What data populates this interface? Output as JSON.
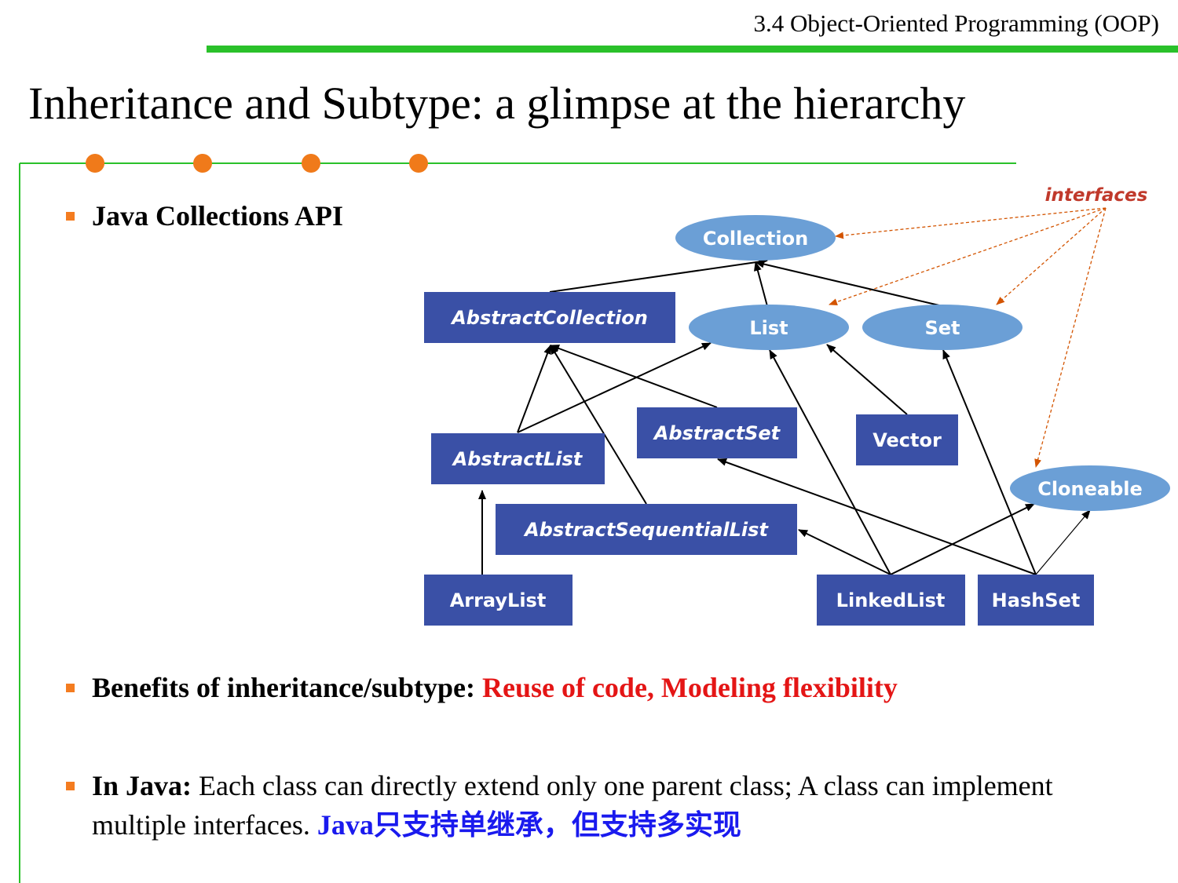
{
  "header": {
    "section": "3.4 Object-Oriented Programming (OOP)",
    "title": "Inheritance and Subtype: a glimpse at the hierarchy"
  },
  "colors": {
    "header_rule": "#2ac12a",
    "frame_line": "#2ac12a",
    "dot": "#f07a1a",
    "bullet": "#f47c20",
    "class_box": "#3a50a6",
    "interface_ellipse": "#6b9fd6",
    "highlight_red": "#e41515",
    "highlight_blue": "#1a1aee",
    "interfaces_note": "#c0392b"
  },
  "bullets": {
    "collections": "Java Collections API",
    "benefits_lead": "Benefits of inheritance/subtype:",
    "benefits_highlight": "Reuse of code, Modeling flexibility",
    "java_lead": "In Java:",
    "java_text": "Each class can directly extend only one parent class; A class can implement multiple interfaces.",
    "java_cn": "Java只支持单继承，但支持多实现"
  },
  "diagram": {
    "interfaces_note": "interfaces",
    "interfaces": [
      {
        "id": "collection",
        "label": "Collection"
      },
      {
        "id": "list",
        "label": "List"
      },
      {
        "id": "set",
        "label": "Set"
      },
      {
        "id": "cloneable",
        "label": "Cloneable"
      }
    ],
    "abstract_classes": [
      {
        "id": "abstract_collection",
        "label": "AbstractCollection"
      },
      {
        "id": "abstract_list",
        "label": "AbstractList"
      },
      {
        "id": "abstract_set",
        "label": "AbstractSet"
      },
      {
        "id": "abstract_sequential_list",
        "label": "AbstractSequentialList"
      }
    ],
    "concrete_classes": [
      {
        "id": "vector",
        "label": "Vector"
      },
      {
        "id": "array_list",
        "label": "ArrayList"
      },
      {
        "id": "linked_list",
        "label": "LinkedList"
      },
      {
        "id": "hash_set",
        "label": "HashSet"
      }
    ]
  }
}
